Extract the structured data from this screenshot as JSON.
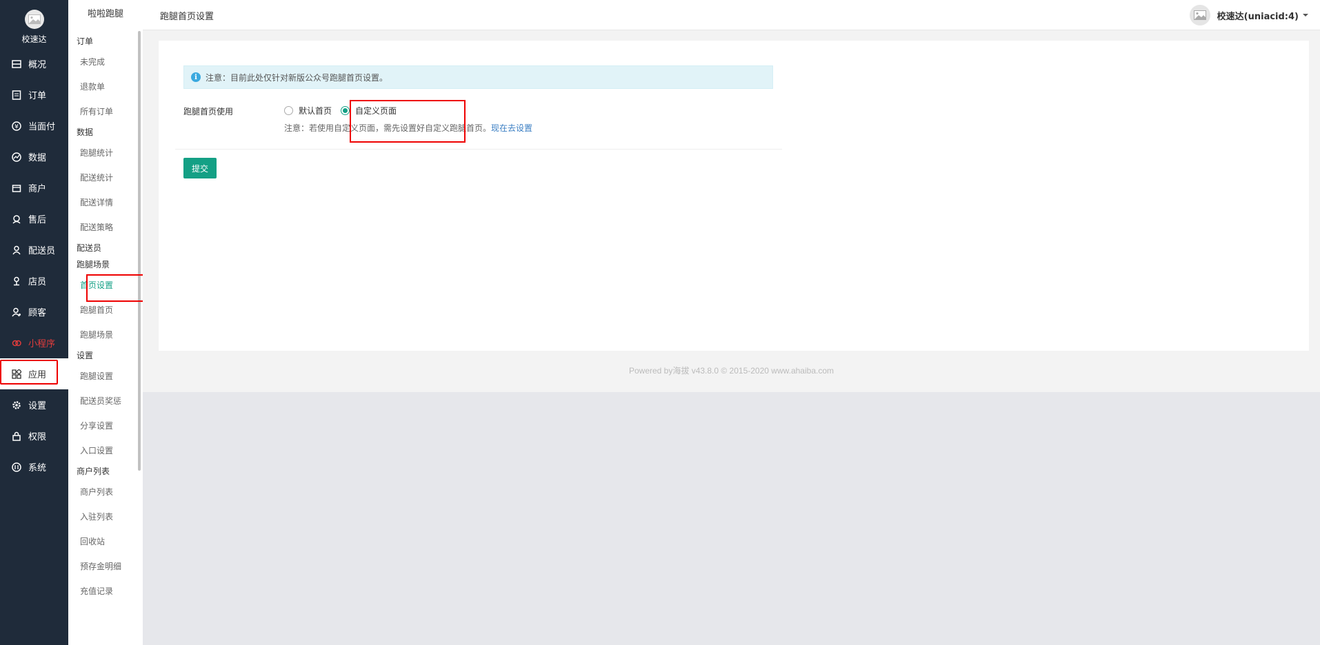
{
  "brand": {
    "name": "校速达"
  },
  "main_nav": [
    {
      "label": "概况",
      "icon": "dashboard-icon"
    },
    {
      "label": "订单",
      "icon": "order-icon"
    },
    {
      "label": "当面付",
      "icon": "yen-icon"
    },
    {
      "label": "数据",
      "icon": "chart-icon"
    },
    {
      "label": "商户",
      "icon": "store-icon"
    },
    {
      "label": "售后",
      "icon": "support-icon"
    },
    {
      "label": "配送员",
      "icon": "courier-icon"
    },
    {
      "label": "店员",
      "icon": "clerk-icon"
    },
    {
      "label": "顾客",
      "icon": "customer-icon"
    },
    {
      "label": "小程序",
      "icon": "miniapp-icon"
    },
    {
      "label": "应用",
      "icon": "apps-icon"
    },
    {
      "label": "设置",
      "icon": "gear-icon"
    },
    {
      "label": "权限",
      "icon": "lock-icon"
    },
    {
      "label": "系统",
      "icon": "system-icon"
    }
  ],
  "sub_sidebar": {
    "title": "啦啦跑腿",
    "groups": [
      {
        "label": "订单",
        "items": [
          "未完成",
          "退款单",
          "所有订单"
        ]
      },
      {
        "label": "数据",
        "items": [
          "跑腿统计",
          "配送统计",
          "配送详情",
          "配送策略"
        ]
      },
      {
        "label": "配送员",
        "items": []
      },
      {
        "label": "跑腿场景",
        "items": [
          "首页设置",
          "跑腿首页",
          "跑腿场景"
        ]
      },
      {
        "label": "设置",
        "items": [
          "跑腿设置",
          "配送员奖惩",
          "分享设置",
          "入口设置"
        ]
      },
      {
        "label": "商户列表",
        "items": [
          "商户列表",
          "入驻列表",
          "回收站",
          "预存金明细",
          "充值记录"
        ]
      }
    ]
  },
  "header": {
    "page_title": "跑腿首页设置",
    "user_name": "校速达(uniacid:4)"
  },
  "form": {
    "notice": "注意：目前此处仅针对新版公众号跑腿首页设置。",
    "label": "跑腿首页使用",
    "options": [
      "默认首页",
      "自定义页面"
    ],
    "selected": "自定义页面",
    "help_text": "注意：若使用自定义页面，需先设置好自定义跑腿首页。",
    "help_link": "现在去设置",
    "submit_label": "提交"
  },
  "footer": {
    "text": "Powered by海拔 v43.8.0 © 2015-2020 www.ahaiba.com"
  }
}
